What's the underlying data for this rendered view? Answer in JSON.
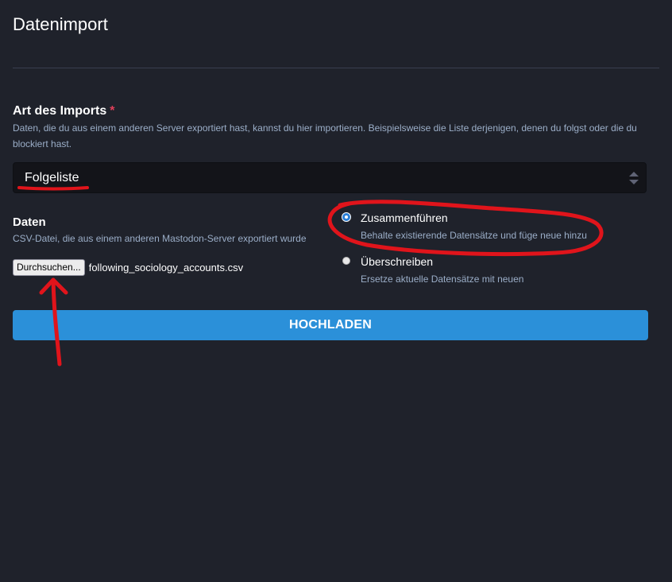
{
  "page": {
    "title": "Datenimport"
  },
  "import_type": {
    "label": "Art des Imports",
    "required_mark": "*",
    "hint": "Daten, die du aus einem anderen Server exportiert hast, kannst du hier importieren. Beispielsweise die Liste derjenigen, denen du folgst oder die du blockiert hast.",
    "selected": "Folgeliste"
  },
  "data_field": {
    "label": "Daten",
    "hint": "CSV-Datei, die aus einem anderen Mastodon-Server exportiert wurde",
    "browse_label": "Durchsuchen...",
    "file_name": "following_sociology_accounts.csv"
  },
  "mode": {
    "options": [
      {
        "title": "Zusammenführen",
        "description": "Behalte existierende Datensätze und füge neue hinzu",
        "checked": true
      },
      {
        "title": "Überschreiben",
        "description": "Ersetze aktuelle Datensätze mit neuen",
        "checked": false
      }
    ]
  },
  "actions": {
    "upload_label": "HOCHLADEN"
  },
  "colors": {
    "background": "#1f222b",
    "accent": "#2b90d9",
    "annotation": "#e0141b",
    "hint_text": "#9baec8"
  }
}
